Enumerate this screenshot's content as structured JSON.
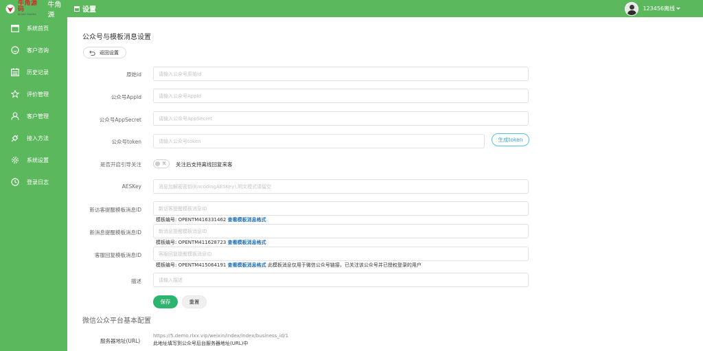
{
  "brand": {
    "logo_cn": "牛角源码",
    "logo_en": "NIUJIAO YUANMA",
    "name": "牛角源",
    "accent": "#5cb85c"
  },
  "header": {
    "title": "设置",
    "title_icon": "panel-icon",
    "user": "123456离线"
  },
  "sidebar": {
    "items": [
      {
        "label": "系统首页",
        "icon": "window-icon"
      },
      {
        "label": "客户咨询",
        "icon": "chat-icon"
      },
      {
        "label": "历史记录",
        "icon": "calendar-icon"
      },
      {
        "label": "评价管理",
        "icon": "star-icon"
      },
      {
        "label": "客户管理",
        "icon": "user-icon"
      },
      {
        "label": "接入方法",
        "icon": "plug-icon"
      },
      {
        "label": "系统设置",
        "icon": "gear-icon"
      },
      {
        "label": "登录日志",
        "icon": "clock-icon"
      }
    ]
  },
  "page": {
    "title": "公众号与模板消息设置",
    "back_label": "返回设置"
  },
  "form": {
    "original_id": {
      "label": "原始id",
      "placeholder": "请输入公众号原始id"
    },
    "appid": {
      "label": "公众号AppId",
      "placeholder": "请输入公众号AppId"
    },
    "appsecret": {
      "label": "公众号AppSecret",
      "placeholder": "请输入公众号AppSecret"
    },
    "token": {
      "label": "公众号token",
      "placeholder": "请输入公众号token",
      "button": "生成token"
    },
    "guide": {
      "label": "是否开启引导关注",
      "switch_label": "关",
      "switch_state": "off",
      "text": "关注后支持离线回复来客"
    },
    "aeskey": {
      "label": "AESKey",
      "placeholder": "消息加解密密钥(EncodingAESKey),明文模式请留空"
    },
    "new_visitor": {
      "label": "新访客提醒模板消息ID",
      "placeholder": "新访客提醒模板消息ID",
      "hint_prefix": "模板编号: OPENTM416331462 ",
      "hint_link": "查看模板消息格式"
    },
    "new_message": {
      "label": "新消息提醒模板消息ID",
      "placeholder": "新消息提醒模板消息ID",
      "hint_prefix": "模板编号: OPENTM411628723 ",
      "hint_link": "查看模板消息格式"
    },
    "reply": {
      "label": "客服回复模板消息ID",
      "placeholder": "客服回复提醒模板消息ID",
      "hint_prefix": "模板编号: OPENTM415064191 ",
      "hint_link": "查看模板消息格式",
      "hint_suffix": " 此模板消息仅用于微信公众号链接，已关注该公众号并已授权登录的用户"
    },
    "desc": {
      "label": "描述",
      "placeholder": "请输入描述"
    },
    "save": "保存",
    "reset": "重置"
  },
  "wechat": {
    "section_title": "微信公众平台基本配置",
    "server_label": "服务器地址(URL)",
    "server_url": "https://5.demo.rlxx.vip/weixin/index/index/business_id/1",
    "server_note": "此地址填写到公众号后台服务器地址(URL)中"
  }
}
